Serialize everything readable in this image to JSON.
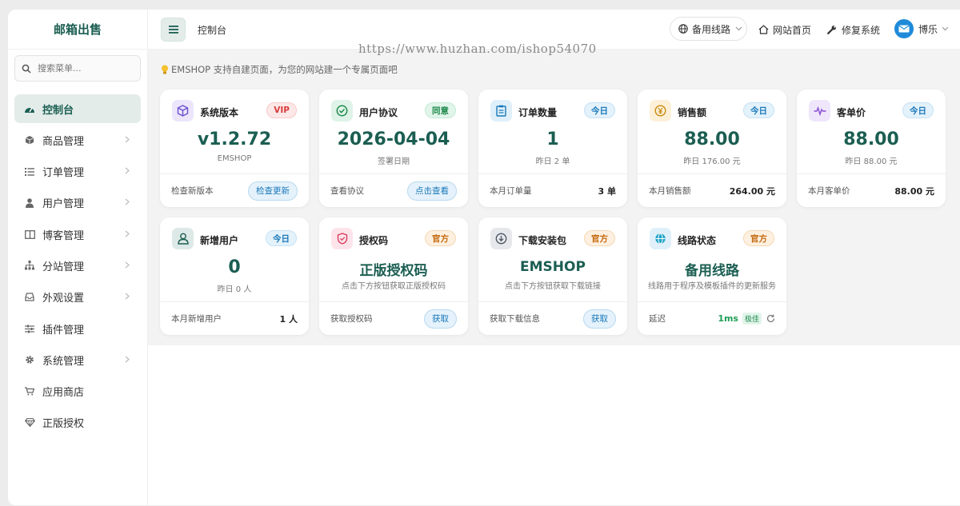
{
  "brand": "邮箱出售",
  "search": {
    "placeholder": "搜索菜单..."
  },
  "sidebar": {
    "items": [
      {
        "label": "控制台",
        "icon": "dashboard-icon",
        "active": true
      },
      {
        "label": "商品管理",
        "icon": "box-icon"
      },
      {
        "label": "订单管理",
        "icon": "list-icon"
      },
      {
        "label": "用户管理",
        "icon": "user-icon"
      },
      {
        "label": "博客管理",
        "icon": "book-icon"
      },
      {
        "label": "分站管理",
        "icon": "sitemap-icon"
      },
      {
        "label": "外观设置",
        "icon": "inbox-icon"
      },
      {
        "label": "插件管理",
        "icon": "sliders-icon"
      },
      {
        "label": "系统管理",
        "icon": "gear-icon"
      },
      {
        "label": "应用商店",
        "icon": "cart-icon"
      },
      {
        "label": "正版授权",
        "icon": "diamond-icon"
      }
    ]
  },
  "header": {
    "breadcrumb": "控制台",
    "line_select": "备用线路",
    "site_home": "网站首页",
    "repair": "修复系统",
    "user": "博乐"
  },
  "watermark": "https://www.huzhan.com/ishop54070",
  "tip": "EMSHOP 支持自建页面，为您的网站建一个专属页面吧",
  "cards": {
    "version": {
      "title": "系统版本",
      "badge": "VIP",
      "value": "v1.2.72",
      "sub": "EMSHOP",
      "foot": "检查新版本",
      "action": "检查更新"
    },
    "agreement": {
      "title": "用户协议",
      "badge": "同意",
      "value": "2026-04-04",
      "sub": "签署日期",
      "foot": "查看协议",
      "action": "点击查看"
    },
    "orders": {
      "title": "订单数量",
      "badge": "今日",
      "value": "1",
      "sub": "昨日 2 单",
      "foot": "本月订单量",
      "foot_value": "3 单"
    },
    "sales": {
      "title": "销售额",
      "badge": "今日",
      "value": "88.00",
      "sub": "昨日 176.00 元",
      "foot": "本月销售额",
      "foot_value": "264.00 元"
    },
    "avg": {
      "title": "客单价",
      "badge": "今日",
      "value": "88.00",
      "sub": "昨日 88.00 元",
      "foot": "本月客单价",
      "foot_value": "88.00 元"
    },
    "newusers": {
      "title": "新增用户",
      "badge": "今日",
      "value": "0",
      "sub": "昨日 0 人",
      "foot": "本月新增用户",
      "foot_value": "1 人"
    },
    "license": {
      "title": "授权码",
      "badge": "官方",
      "value": "正版授权码",
      "sub": "点击下方按钮获取正版授权码",
      "foot": "获取授权码",
      "action": "获取"
    },
    "download": {
      "title": "下载安装包",
      "badge": "官方",
      "value": "EMSHOP",
      "sub": "点击下方按钮获取下载链接",
      "foot": "获取下载信息",
      "action": "获取"
    },
    "route": {
      "title": "线路状态",
      "badge": "官方",
      "value": "备用线路",
      "sub": "线路用于程序及模板插件的更新服务",
      "foot": "延迟",
      "latency": "1ms",
      "quality": "极佳"
    }
  }
}
